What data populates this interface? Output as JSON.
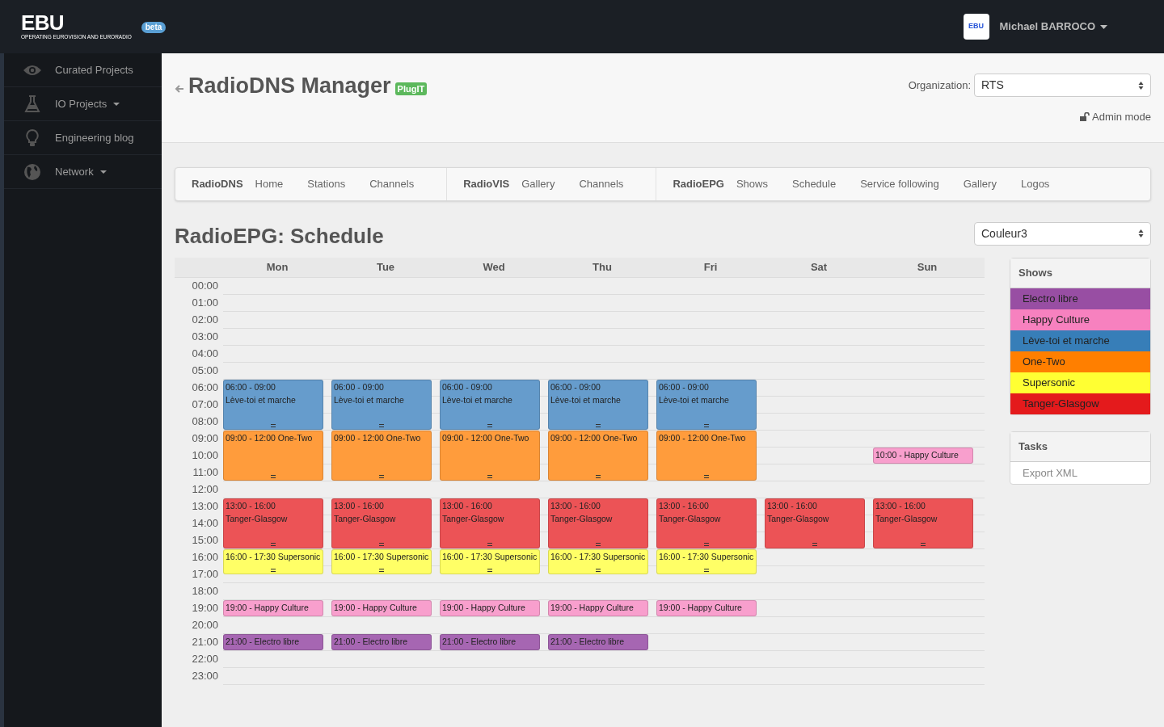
{
  "topbar": {
    "logo": "EBU",
    "tagline": "OPERATING EUROVISION AND EURORADIO",
    "badge": "beta",
    "avatar_text": "EBU",
    "user": "Michael BARROCO"
  },
  "sidebar": {
    "items": [
      {
        "label": "Curated Projects",
        "dropdown": false
      },
      {
        "label": "IO Projects",
        "dropdown": true
      },
      {
        "label": "Engineering blog",
        "dropdown": false
      },
      {
        "label": "Network",
        "dropdown": true
      }
    ]
  },
  "header": {
    "title": "RadioDNS Manager",
    "badge": "PlugIT",
    "organization_label": "Organization:",
    "organization": "RTS",
    "admin_mode": "Admin mode"
  },
  "nav": [
    {
      "brand": "RadioDNS",
      "links": [
        "Home",
        "Stations",
        "Channels"
      ]
    },
    {
      "brand": "RadioVIS",
      "links": [
        "Gallery",
        "Channels"
      ]
    },
    {
      "brand": "RadioEPG",
      "links": [
        "Shows",
        "Schedule",
        "Service following",
        "Gallery",
        "Logos"
      ]
    }
  ],
  "page_title": "RadioEPG: Schedule",
  "station": "Couleur3",
  "hours": [
    "00:00",
    "01:00",
    "02:00",
    "03:00",
    "04:00",
    "05:00",
    "06:00",
    "07:00",
    "08:00",
    "09:00",
    "10:00",
    "11:00",
    "12:00",
    "13:00",
    "14:00",
    "15:00",
    "16:00",
    "17:00",
    "18:00",
    "19:00",
    "20:00",
    "21:00",
    "22:00",
    "23:00"
  ],
  "days": [
    {
      "label": "Mon",
      "events": [
        {
          "lines": [
            "06:00 - 09:00",
            "Lève-toi et marche"
          ],
          "color": "#669ccc"
        },
        {
          "lines": [
            "09:00 - 12:00 One-Two"
          ],
          "color": "#ff9c3c"
        },
        {
          "lines": [
            "13:00 - 16:00",
            "Tanger-Glasgow"
          ],
          "color": "#ec5356"
        },
        {
          "lines": [
            "16:00 - 17:30 Supersonic"
          ],
          "color": "#ffff66"
        },
        {
          "lines": [
            "19:00 - Happy Culture"
          ],
          "color": "#f89fcd"
        },
        {
          "lines": [
            "21:00 - Electro libre"
          ],
          "color": "#a666b2"
        }
      ]
    },
    {
      "label": "Tue",
      "events": [
        {
          "lines": [
            "06:00 - 09:00",
            "Lève-toi et marche"
          ],
          "color": "#669ccc"
        },
        {
          "lines": [
            "09:00 - 12:00 One-Two"
          ],
          "color": "#ff9c3c"
        },
        {
          "lines": [
            "13:00 - 16:00",
            "Tanger-Glasgow"
          ],
          "color": "#ec5356"
        },
        {
          "lines": [
            "16:00 - 17:30 Supersonic"
          ],
          "color": "#ffff66"
        },
        {
          "lines": [
            "19:00 - Happy Culture"
          ],
          "color": "#f89fcd"
        },
        {
          "lines": [
            "21:00 - Electro libre"
          ],
          "color": "#a666b2"
        }
      ]
    },
    {
      "label": "Wed",
      "events": [
        {
          "lines": [
            "06:00 - 09:00",
            "Lève-toi et marche"
          ],
          "color": "#669ccc"
        },
        {
          "lines": [
            "09:00 - 12:00 One-Two"
          ],
          "color": "#ff9c3c"
        },
        {
          "lines": [
            "13:00 - 16:00",
            "Tanger-Glasgow"
          ],
          "color": "#ec5356"
        },
        {
          "lines": [
            "16:00 - 17:30 Supersonic"
          ],
          "color": "#ffff66"
        },
        {
          "lines": [
            "19:00 - Happy Culture"
          ],
          "color": "#f89fcd"
        },
        {
          "lines": [
            "21:00 - Electro libre"
          ],
          "color": "#a666b2"
        }
      ]
    },
    {
      "label": "Thu",
      "events": [
        {
          "lines": [
            "06:00 - 09:00",
            "Lève-toi et marche"
          ],
          "color": "#669ccc"
        },
        {
          "lines": [
            "09:00 - 12:00 One-Two"
          ],
          "color": "#ff9c3c"
        },
        {
          "lines": [
            "13:00 - 16:00",
            "Tanger-Glasgow"
          ],
          "color": "#ec5356"
        },
        {
          "lines": [
            "16:00 - 17:30 Supersonic"
          ],
          "color": "#ffff66"
        },
        {
          "lines": [
            "19:00 - Happy Culture"
          ],
          "color": "#f89fcd"
        },
        {
          "lines": [
            "21:00 - Electro libre"
          ],
          "color": "#a666b2"
        }
      ]
    },
    {
      "label": "Fri",
      "events": [
        {
          "lines": [
            "06:00 - 09:00",
            "Lève-toi et marche"
          ],
          "color": "#669ccc"
        },
        {
          "lines": [
            "09:00 - 12:00 One-Two"
          ],
          "color": "#ff9c3c"
        },
        {
          "lines": [
            "13:00 - 16:00",
            "Tanger-Glasgow"
          ],
          "color": "#ec5356"
        },
        {
          "lines": [
            "16:00 - 17:30 Supersonic"
          ],
          "color": "#ffff66"
        },
        {
          "lines": [
            "19:00 - Happy Culture"
          ],
          "color": "#f89fcd"
        }
      ]
    },
    {
      "label": "Sat",
      "events": [
        {
          "lines": [
            "13:00 - 16:00",
            "Tanger-Glasgow"
          ],
          "color": "#ec5356"
        }
      ]
    },
    {
      "label": "Sun",
      "events": [
        {
          "lines": [
            "10:00 - Happy Culture"
          ],
          "color": "#f89fcd"
        },
        {
          "lines": [
            "13:00 - 16:00",
            "Tanger-Glasgow"
          ],
          "color": "#ec5356"
        }
      ]
    }
  ],
  "shows_panel": {
    "title": "Shows",
    "items": [
      {
        "label": "Electro libre",
        "color": "#984ea3"
      },
      {
        "label": "Happy Culture",
        "color": "#f781bf"
      },
      {
        "label": "Lève-toi et marche",
        "color": "#377eb8"
      },
      {
        "label": "One-Two",
        "color": "#ff7f00"
      },
      {
        "label": "Supersonic",
        "color": "#ffff33"
      },
      {
        "label": "Tanger-Glasgow",
        "color": "#e41a1c"
      }
    ]
  },
  "tasks_panel": {
    "title": "Tasks",
    "items": [
      "Export XML"
    ]
  }
}
